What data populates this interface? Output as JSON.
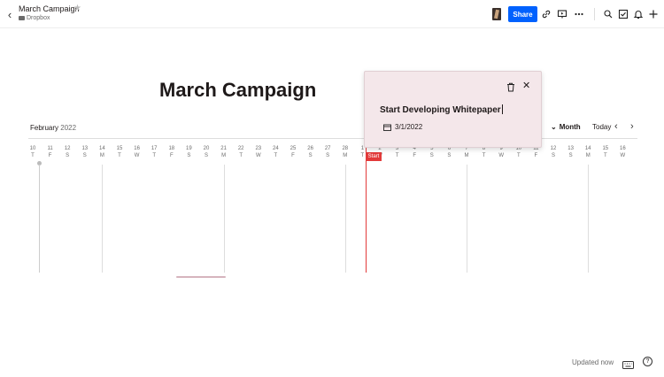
{
  "header": {
    "title": "March Campaign",
    "location": "Dropbox",
    "share_label": "Share",
    "icons": [
      "back-arrow-icon",
      "star-icon",
      "link-icon",
      "present-icon",
      "more-icon",
      "search-icon",
      "checkbox-icon",
      "bell-icon",
      "plus-icon"
    ]
  },
  "page": {
    "title": "March Campaign"
  },
  "timeline": {
    "month": "February",
    "year": "2022",
    "view_label": "Month",
    "today_label": "Today",
    "start_label": "Start",
    "days": [
      {
        "n": "10",
        "w": "T"
      },
      {
        "n": "11",
        "w": "F"
      },
      {
        "n": "12",
        "w": "S"
      },
      {
        "n": "13",
        "w": "S"
      },
      {
        "n": "14",
        "w": "M"
      },
      {
        "n": "15",
        "w": "T"
      },
      {
        "n": "16",
        "w": "W"
      },
      {
        "n": "17",
        "w": "T"
      },
      {
        "n": "18",
        "w": "F"
      },
      {
        "n": "19",
        "w": "S"
      },
      {
        "n": "20",
        "w": "S"
      },
      {
        "n": "21",
        "w": "M"
      },
      {
        "n": "22",
        "w": "T"
      },
      {
        "n": "23",
        "w": "W"
      },
      {
        "n": "24",
        "w": "T"
      },
      {
        "n": "25",
        "w": "F"
      },
      {
        "n": "26",
        "w": "S"
      },
      {
        "n": "27",
        "w": "S"
      },
      {
        "n": "28",
        "w": "M"
      },
      {
        "n": "1",
        "w": "T"
      },
      {
        "n": "2",
        "w": "W"
      },
      {
        "n": "3",
        "w": "T"
      },
      {
        "n": "4",
        "w": "F"
      },
      {
        "n": "5",
        "w": "S"
      },
      {
        "n": "6",
        "w": "S"
      },
      {
        "n": "7",
        "w": "M"
      },
      {
        "n": "8",
        "w": "T"
      },
      {
        "n": "9",
        "w": "W"
      },
      {
        "n": "10",
        "w": "T"
      },
      {
        "n": "11",
        "w": "F"
      },
      {
        "n": "12",
        "w": "S"
      },
      {
        "n": "13",
        "w": "S"
      },
      {
        "n": "14",
        "w": "M"
      },
      {
        "n": "15",
        "w": "T"
      },
      {
        "n": "16",
        "w": "W"
      }
    ]
  },
  "popup": {
    "task_name": "Start Developing Whitepaper",
    "date": "3/1/2022"
  },
  "footer": {
    "status": "Updated now"
  },
  "colors": {
    "accent": "#0061fe",
    "today": "#e23a3a",
    "popup_bg": "#f4e7ea"
  }
}
